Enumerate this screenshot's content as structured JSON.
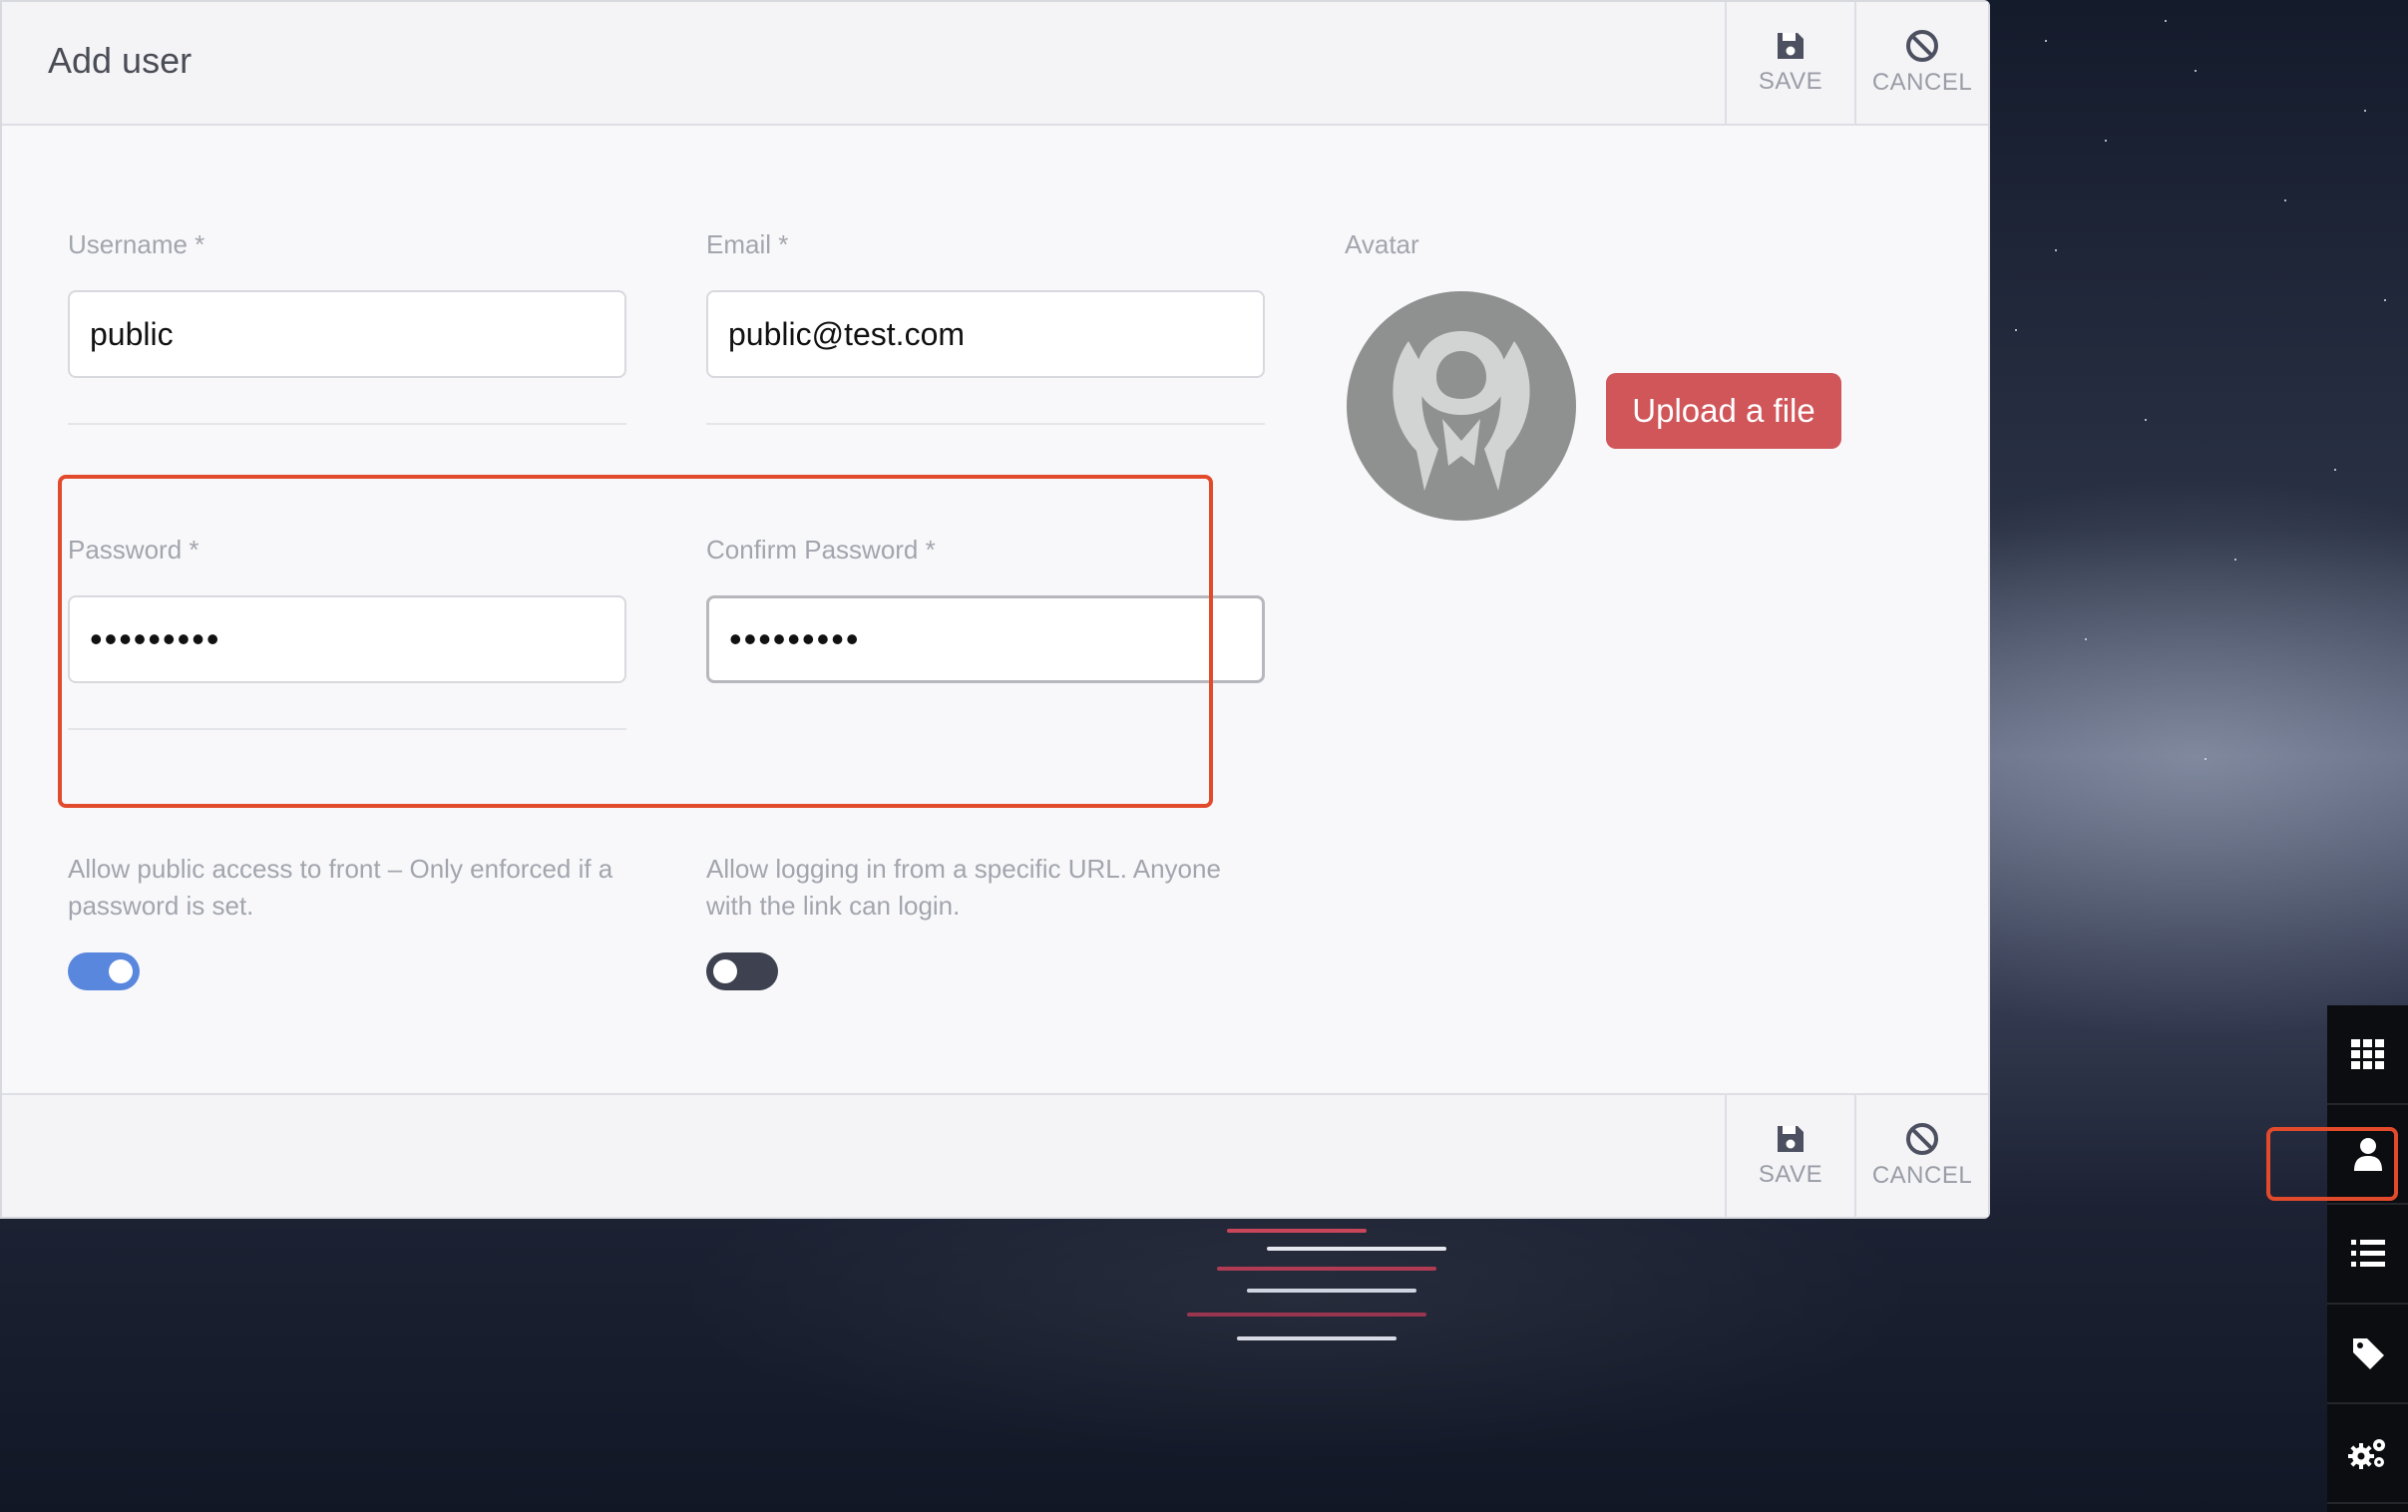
{
  "dialog": {
    "title": "Add user",
    "save_label": "SAVE",
    "cancel_label": "CANCEL"
  },
  "form": {
    "username": {
      "label": "Username *",
      "value": "public"
    },
    "email": {
      "label": "Email *",
      "value": "public@test.com"
    },
    "avatar": {
      "label": "Avatar",
      "upload_label": "Upload a file"
    },
    "password": {
      "label": "Password *",
      "value": "123456789"
    },
    "confirm_password": {
      "label": "Confirm Password *",
      "value": "123456789"
    },
    "public_access": {
      "help": "Allow public access to front – Only enforced if a password is set.",
      "enabled": true
    },
    "url_login": {
      "help": "Allow logging in from a specific URL. Anyone with the link can login.",
      "enabled": false
    }
  },
  "colors": {
    "toggle_on": "#5a87de",
    "toggle_off": "#3d4150",
    "upload_button": "#d0565a",
    "highlight": "#e24a2c"
  },
  "sidebar": {
    "items": [
      {
        "icon": "grid-icon"
      },
      {
        "icon": "user-icon",
        "active": true
      },
      {
        "icon": "list-icon"
      },
      {
        "icon": "tag-icon"
      },
      {
        "icon": "gears-icon"
      }
    ]
  }
}
